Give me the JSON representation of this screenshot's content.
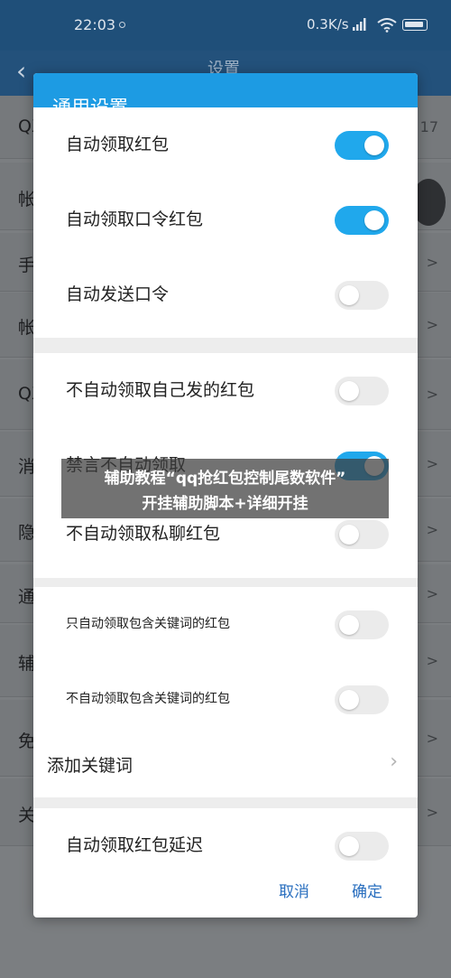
{
  "status_bar": {
    "time": "22:03",
    "net_speed": "0.3K/s",
    "icons": [
      "signal-icon",
      "wifi-icon",
      "battery-icon"
    ]
  },
  "background": {
    "title": "设置",
    "rows": [
      {
        "label": "QX",
        "right": "17"
      },
      {
        "label": "帐",
        "right": ""
      },
      {
        "label": "手",
        "right": ">"
      },
      {
        "label": "帐",
        "right": ">"
      },
      {
        "label": "QX",
        "right": ">"
      },
      {
        "label": "消",
        "right": ">"
      },
      {
        "label": "隐",
        "right": ">"
      },
      {
        "label": "通",
        "right": ">"
      },
      {
        "label": "辅",
        "right": ">"
      },
      {
        "label": "免",
        "right": ">"
      },
      {
        "label": "关",
        "right": ">"
      }
    ]
  },
  "dialog": {
    "title": "通用设置",
    "sections": [
      {
        "items": [
          {
            "label": "自动领取红包",
            "enabled": true
          },
          {
            "label": "自动领取口令红包",
            "enabled": true
          },
          {
            "label": "自动发送口令",
            "enabled": false
          }
        ]
      },
      {
        "items": [
          {
            "label": "不自动领取自己发的红包",
            "enabled": false
          },
          {
            "label": "禁言不自动领取",
            "enabled": true
          },
          {
            "label": "不自动领取私聊红包",
            "enabled": false
          }
        ]
      },
      {
        "items": [
          {
            "label": "只自动领取包含关键词的红包",
            "enabled": false
          },
          {
            "label": "不自动领取包含关键词的红包",
            "enabled": false
          }
        ],
        "link": {
          "label": "添加关键词"
        }
      },
      {
        "items": [
          {
            "label": "自动领取红包延迟",
            "enabled": false
          }
        ]
      }
    ],
    "cancel_label": "取消",
    "confirm_label": "确定"
  },
  "banner": {
    "line1": "辅助教程“qq抢红包控制尾数软件”",
    "line2": "开挂辅助脚本+详细开挂"
  },
  "colors": {
    "dialog_header": "#1d9be3",
    "toggle_on": "#20a8ec",
    "toggle_off": "#ebebeb",
    "footer_button": "#2a6fbf"
  }
}
